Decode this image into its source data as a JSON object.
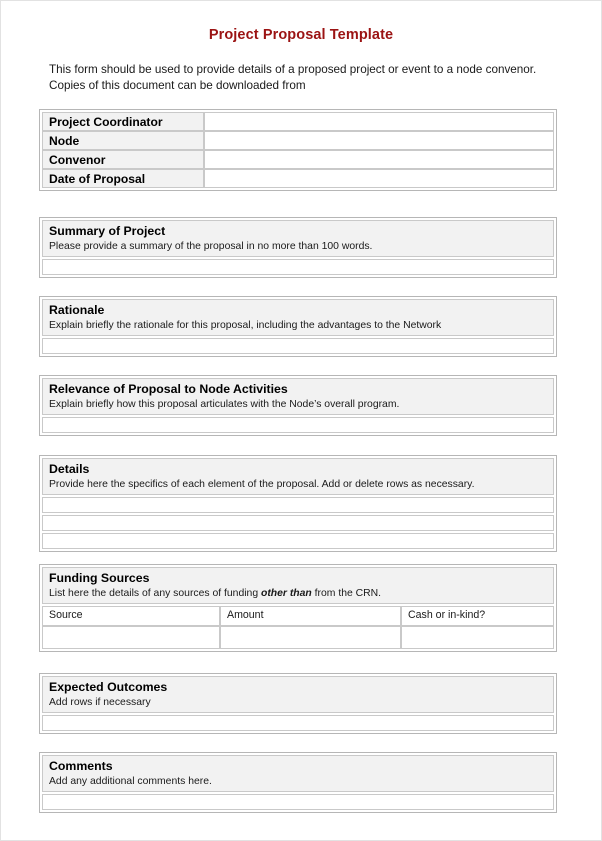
{
  "document": {
    "title": "Project Proposal Template",
    "intro": "This form should be used to provide details of a proposed project or event to a node convenor. Copies of this document can be downloaded from",
    "accent_color": "#9b1313",
    "header_fill": "#f2f2f2",
    "border_color": "#c9c9c9"
  },
  "identification": {
    "rows": [
      {
        "label": "Project Coordinator",
        "value": ""
      },
      {
        "label": "Node",
        "value": ""
      },
      {
        "label": "Convenor",
        "value": ""
      },
      {
        "label": "Date of Proposal",
        "value": ""
      }
    ]
  },
  "sections": [
    {
      "title": "Summary of Project",
      "description": "Please provide a summary of the proposal in no more than 100 words.",
      "field_values": [
        ""
      ]
    },
    {
      "title": "Rationale",
      "description": "Explain briefly the rationale for this proposal, including the advantages to the Network",
      "field_values": [
        ""
      ]
    },
    {
      "title": "Relevance of Proposal to Node Activities",
      "description": "Explain briefly how this proposal articulates with the Node’s overall program.",
      "field_values": [
        ""
      ]
    },
    {
      "title": "Details",
      "description": "Provide here the specifics of each element of the proposal. Add or delete rows as necessary.",
      "field_values": [
        "",
        "",
        ""
      ]
    },
    {
      "title": "Funding Sources",
      "description_before": "List here the details of any sources of funding ",
      "description_emphasis": "other than",
      "description_after": " from the CRN.",
      "columns": [
        "Source",
        "Amount",
        "Cash or in-kind?"
      ],
      "entry_values": [
        "",
        "",
        ""
      ]
    },
    {
      "title": "Expected Outcomes",
      "description": "Add rows if necessary",
      "field_values": [
        ""
      ]
    },
    {
      "title": "Comments",
      "description": "Add any additional comments here.",
      "field_values": [
        ""
      ]
    }
  ]
}
